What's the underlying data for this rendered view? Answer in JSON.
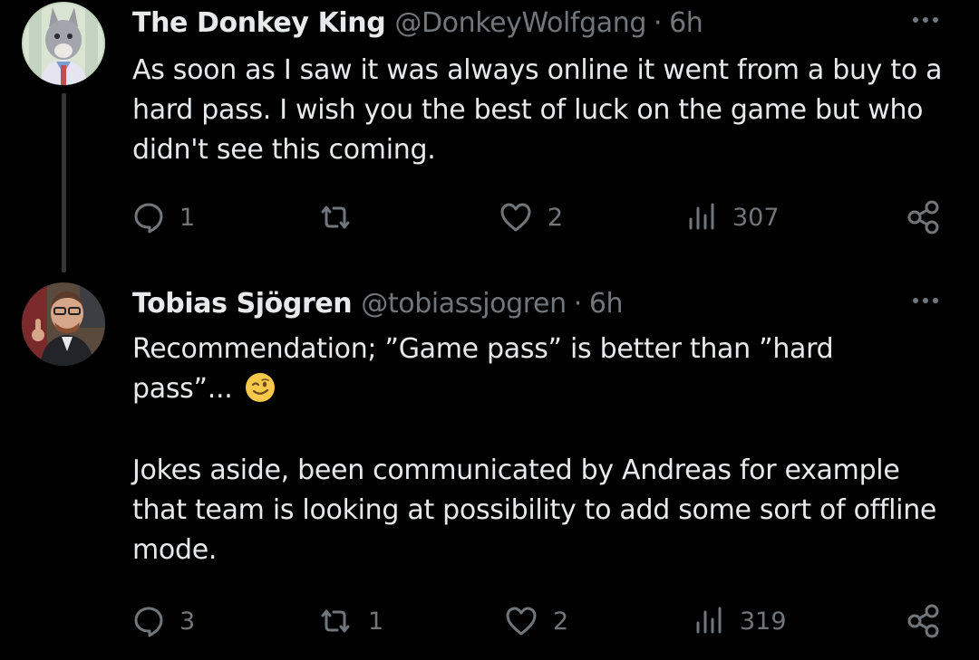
{
  "tweets": [
    {
      "display_name": "The Donkey King",
      "handle": "@DonkeyWolfgang",
      "separator": "·",
      "time": "6h",
      "text": "As soon as I saw it was always online it went from a buy to a hard pass. I wish you the best of luck on the game but who didn't see this coming.",
      "replies": "1",
      "reposts": "",
      "likes": "2",
      "views": "307"
    },
    {
      "display_name": "Tobias Sjögren",
      "handle": "@tobiassjogren",
      "separator": "·",
      "time": "6h",
      "text_line1": "Recommendation; ”Game pass” is better than ”hard pass”... ",
      "emoji": "winking-face",
      "text_paragraph2": "Jokes aside, been communicated by Andreas for example that team is looking at possibility to add some sort of offline mode.",
      "replies": "3",
      "reposts": "1",
      "likes": "2",
      "views": "319"
    }
  ],
  "colors": {
    "background": "#000000",
    "text": "#e7e9ea",
    "secondary": "#71767b",
    "thread_line": "#333639"
  },
  "icons": [
    "reply-icon",
    "repost-icon",
    "like-icon",
    "views-icon",
    "share-icon",
    "more-icon"
  ]
}
